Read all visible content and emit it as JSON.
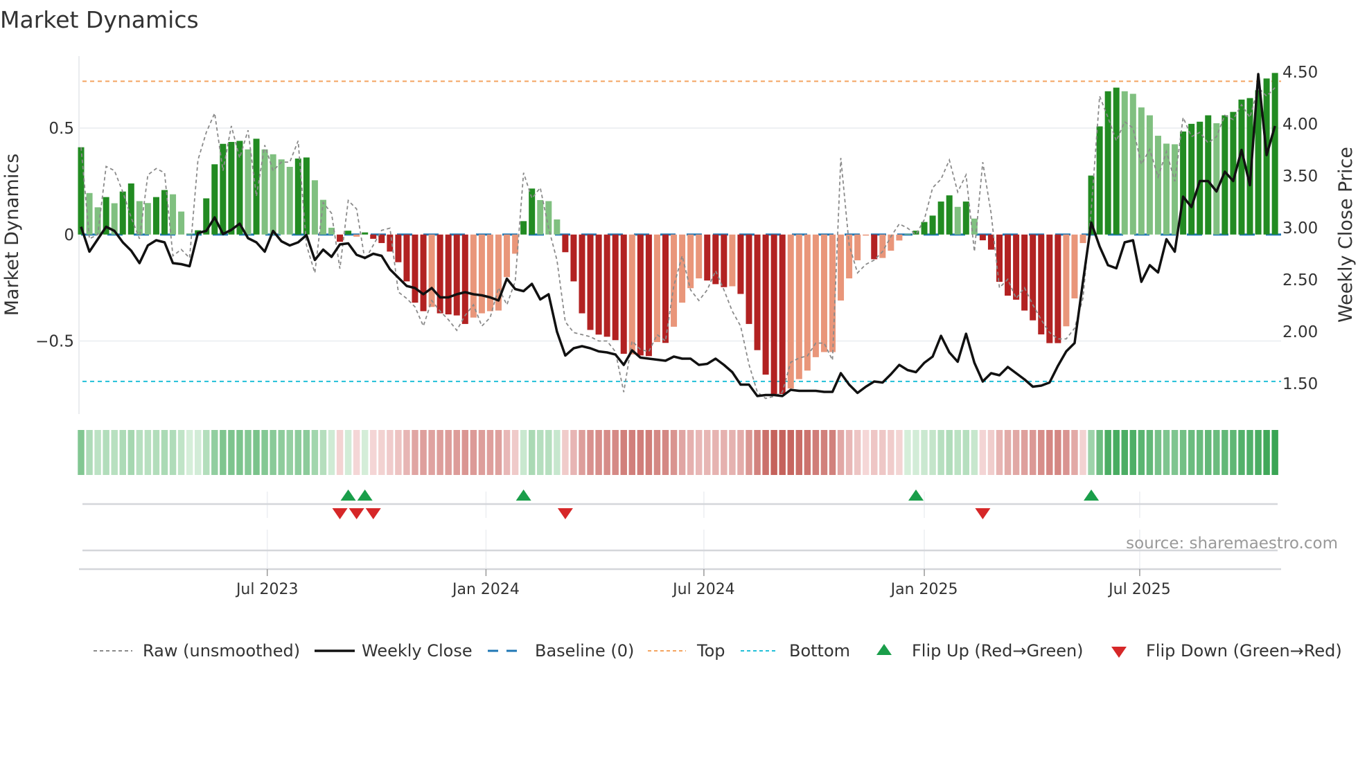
{
  "chart_data": {
    "type": "bar",
    "title": "Market Dynamics",
    "ylabel_left": "Market Dynamics",
    "ylabel_right": "Weekly Close Price",
    "x_unit": "week index",
    "x_ticks": [
      {
        "label": "Jul 2023",
        "index": 22.3
      },
      {
        "label": "Jan 2024",
        "index": 48.5
      },
      {
        "label": "Jul 2024",
        "index": 74.6
      },
      {
        "label": "Jan 2025",
        "index": 101.0
      },
      {
        "label": "Jul 2025",
        "index": 126.8
      }
    ],
    "y_left_ticks": [
      {
        "label": "0.5",
        "value": 0.5
      },
      {
        "label": "0",
        "value": 0
      },
      {
        "label": "−0.5",
        "value": -0.5
      }
    ],
    "y_right_ticks": [
      {
        "label": "1.50",
        "value": 1.5
      },
      {
        "label": "2.00",
        "value": 2.0
      },
      {
        "label": "2.50",
        "value": 2.5
      },
      {
        "label": "3.00",
        "value": 3.0
      },
      {
        "label": "3.50",
        "value": 3.5
      },
      {
        "label": "4.00",
        "value": 4.0
      },
      {
        "label": "4.50",
        "value": 4.5
      }
    ],
    "ylim_left": [
      -0.84,
      0.84
    ],
    "ylim_right": [
      1.3,
      4.7
    ],
    "top_level": 0.72,
    "bottom_level": -0.69,
    "baseline": 0,
    "dynamics": [
      0.41,
      0.195,
      0.128,
      0.176,
      0.147,
      0.202,
      0.24,
      0.157,
      0.148,
      0.176,
      0.209,
      0.189,
      0.108,
      0.005,
      0.02,
      0.17,
      0.33,
      0.426,
      0.435,
      0.44,
      0.4,
      0.45,
      0.4,
      0.377,
      0.353,
      0.318,
      0.357,
      0.362,
      0.255,
      0.163,
      0.032,
      -0.034,
      0.018,
      -0.01,
      0.01,
      -0.02,
      -0.04,
      -0.08,
      -0.13,
      -0.22,
      -0.32,
      -0.36,
      -0.34,
      -0.37,
      -0.375,
      -0.38,
      -0.42,
      -0.39,
      -0.37,
      -0.36,
      -0.357,
      -0.2,
      -0.09,
      0.063,
      0.216,
      0.162,
      0.157,
      0.071,
      -0.083,
      -0.22,
      -0.37,
      -0.448,
      -0.47,
      -0.48,
      -0.496,
      -0.56,
      -0.563,
      -0.568,
      -0.571,
      -0.505,
      -0.509,
      -0.433,
      -0.32,
      -0.252,
      -0.206,
      -0.216,
      -0.233,
      -0.247,
      -0.243,
      -0.279,
      -0.42,
      -0.543,
      -0.658,
      -0.749,
      -0.749,
      -0.723,
      -0.679,
      -0.639,
      -0.576,
      -0.552,
      -0.552,
      -0.31,
      -0.206,
      -0.121,
      -0.005,
      -0.116,
      -0.11,
      -0.076,
      -0.028,
      0.003,
      0.018,
      0.059,
      0.089,
      0.155,
      0.184,
      0.13,
      0.155,
      0.075,
      -0.027,
      -0.071,
      -0.222,
      -0.287,
      -0.306,
      -0.357,
      -0.403,
      -0.469,
      -0.51,
      -0.51,
      -0.431,
      -0.3,
      -0.04,
      0.277,
      0.508,
      0.673,
      0.69,
      0.673,
      0.661,
      0.597,
      0.56,
      0.464,
      0.427,
      0.424,
      0.484,
      0.52,
      0.53,
      0.56,
      0.523,
      0.56,
      0.576,
      0.634,
      0.641,
      0.678,
      0.733,
      0.759
    ],
    "shade": "DLLDLDDLLDDLLLDDDDDDLDLLLLDDLLLDDLDDDDDDDDLDDDDLLLLLLDDLLLDDDDDDDDLDDLDLLLLDDDLDDDDDDLLLLLLLLLLDLLLLDDDDDLDLDDDDDDDDDDLLLDDDDLLLLLLLDDDDLDDDDDDD",
    "raw": [
      0.41,
      -0.02,
      0.0,
      0.32,
      0.3,
      0.2,
      0.08,
      -0.02,
      0.28,
      0.31,
      0.29,
      -0.1,
      -0.07,
      -0.11,
      0.35,
      0.48,
      0.57,
      0.3,
      0.51,
      0.36,
      0.49,
      0.18,
      0.42,
      0.3,
      0.34,
      0.34,
      0.44,
      -0.05,
      -0.18,
      0.15,
      0.1,
      -0.16,
      0.16,
      0.12,
      -0.12,
      -0.05,
      0.02,
      0.03,
      -0.27,
      -0.3,
      -0.34,
      -0.43,
      -0.31,
      -0.36,
      -0.4,
      -0.45,
      -0.38,
      -0.33,
      -0.43,
      -0.39,
      -0.25,
      -0.33,
      -0.22,
      0.29,
      0.17,
      0.22,
      0.03,
      -0.12,
      -0.41,
      -0.46,
      -0.47,
      -0.48,
      -0.5,
      -0.5,
      -0.55,
      -0.74,
      -0.5,
      -0.54,
      -0.55,
      -0.47,
      -0.5,
      -0.24,
      -0.1,
      -0.26,
      -0.31,
      -0.26,
      -0.17,
      -0.26,
      -0.36,
      -0.43,
      -0.61,
      -0.74,
      -0.77,
      -0.76,
      -0.74,
      -0.6,
      -0.58,
      -0.57,
      -0.51,
      -0.51,
      -0.59,
      0.36,
      -0.05,
      -0.18,
      -0.14,
      -0.12,
      -0.08,
      -0.01,
      0.05,
      0.03,
      0.0,
      0.07,
      0.22,
      0.26,
      0.35,
      0.2,
      0.28,
      -0.08,
      0.34,
      0.1,
      -0.25,
      -0.21,
      -0.3,
      -0.25,
      -0.33,
      -0.4,
      -0.46,
      -0.49,
      -0.49,
      -0.44,
      -0.3,
      0.12,
      0.65,
      0.55,
      0.44,
      0.53,
      0.5,
      0.33,
      0.4,
      0.27,
      0.39,
      0.25,
      0.55,
      0.46,
      0.48,
      0.43,
      0.46,
      0.56,
      0.54,
      0.61,
      0.55,
      0.69,
      0.65,
      0.69
    ],
    "weekly_close": [
      3.01,
      2.77,
      2.89,
      3.01,
      2.97,
      2.86,
      2.78,
      2.66,
      2.83,
      2.88,
      2.86,
      2.66,
      2.65,
      2.63,
      2.95,
      2.97,
      3.1,
      2.94,
      2.98,
      3.04,
      2.9,
      2.86,
      2.77,
      2.97,
      2.87,
      2.83,
      2.86,
      2.93,
      2.69,
      2.79,
      2.72,
      2.84,
      2.85,
      2.74,
      2.71,
      2.75,
      2.73,
      2.6,
      2.52,
      2.44,
      2.42,
      2.36,
      2.42,
      2.33,
      2.33,
      2.36,
      2.38,
      2.36,
      2.35,
      2.33,
      2.3,
      2.51,
      2.41,
      2.39,
      2.46,
      2.31,
      2.36,
      2.0,
      1.77,
      1.84,
      1.86,
      1.84,
      1.81,
      1.8,
      1.78,
      1.68,
      1.82,
      1.75,
      1.74,
      1.73,
      1.72,
      1.76,
      1.74,
      1.74,
      1.68,
      1.69,
      1.74,
      1.68,
      1.61,
      1.49,
      1.49,
      1.38,
      1.39,
      1.39,
      1.38,
      1.44,
      1.43,
      1.43,
      1.43,
      1.42,
      1.42,
      1.6,
      1.49,
      1.41,
      1.47,
      1.52,
      1.51,
      1.59,
      1.68,
      1.63,
      1.61,
      1.7,
      1.76,
      1.96,
      1.8,
      1.71,
      1.98,
      1.7,
      1.52,
      1.6,
      1.58,
      1.66,
      1.6,
      1.54,
      1.47,
      1.48,
      1.51,
      1.67,
      1.81,
      1.89,
      2.48,
      3.05,
      2.82,
      2.64,
      2.61,
      2.86,
      2.88,
      2.48,
      2.64,
      2.57,
      2.89,
      2.77,
      3.3,
      3.2,
      3.45,
      3.45,
      3.35,
      3.54,
      3.45,
      3.75,
      3.41,
      4.48,
      3.7,
      3.98
    ],
    "flip_up": [
      32,
      34,
      53,
      100,
      121
    ],
    "flip_down": [
      31,
      33,
      35,
      58,
      108
    ],
    "legend": {
      "raw": "Raw (unsmoothed)",
      "close": "Weekly Close",
      "baseline": "Baseline (0)",
      "top": "Top",
      "bottom": "Bottom",
      "flip_up": "Flip Up (Red→Green)",
      "flip_down": "Flip Down (Green→Red)"
    },
    "legend_placement": "bottom",
    "source": "source: sharemaestro.com",
    "colors": {
      "green_strong": "#228b22",
      "green_weak": "#80c080",
      "red_strong": "#b22222",
      "red_weak": "#e9967a",
      "baseline": "#1f77b4",
      "top": "#f4a460",
      "bottom": "#22c0d8",
      "raw": "#8a8a8a",
      "close": "#111111",
      "flip_up": "#1a9e4a",
      "flip_down": "#d62728"
    }
  }
}
